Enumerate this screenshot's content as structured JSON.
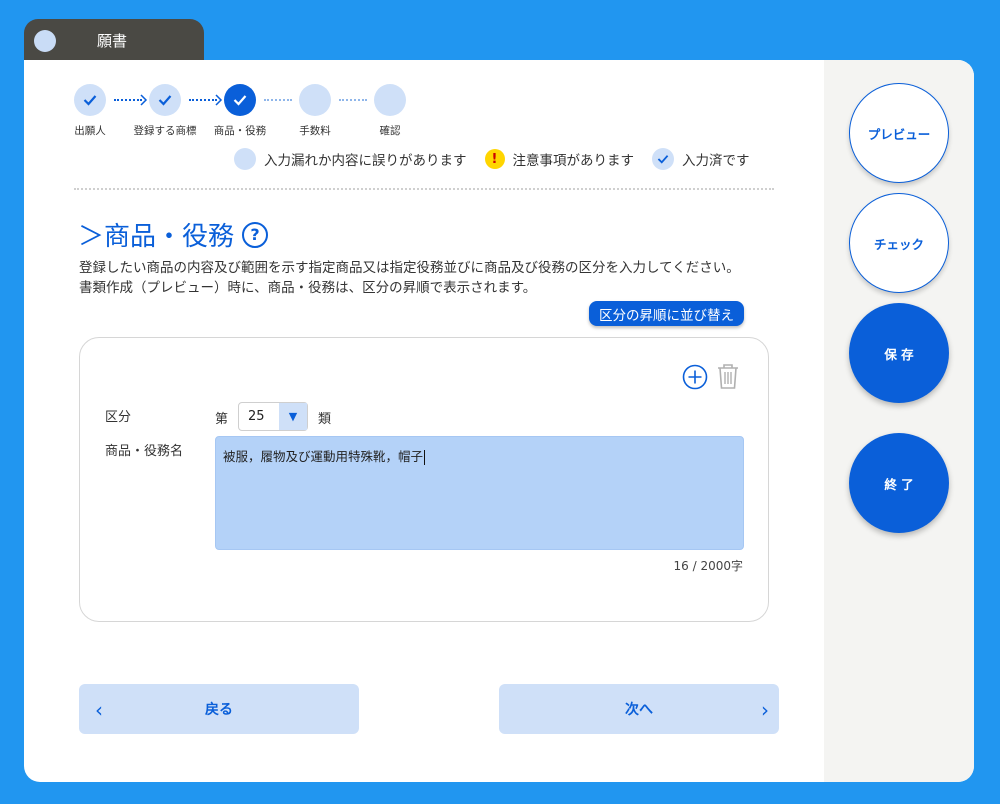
{
  "window": {
    "title": "願書"
  },
  "stepper": {
    "steps": [
      {
        "label": "出願人",
        "state": "done"
      },
      {
        "label": "登録する商標",
        "state": "done"
      },
      {
        "label": "商品・役務",
        "state": "current"
      },
      {
        "label": "手数料",
        "state": "pending"
      },
      {
        "label": "確認",
        "state": "pending"
      }
    ]
  },
  "legend": {
    "missing": "入力漏れか内容に誤りがあります",
    "warning": "注意事項があります",
    "done": "入力済です"
  },
  "section": {
    "prefix": "＞",
    "title": "商品・役務",
    "help_symbol": "?",
    "desc_line1": "登録したい商品の内容及び範囲を示す指定商品又は指定役務並びに商品及び役務の区分を入力してください。",
    "desc_line2": "書類作成（プレビュー）時に、商品・役務は、区分の昇順で表示されます。",
    "sort_button": "区分の昇順に並び替え"
  },
  "form": {
    "class_label": "区分",
    "class_prefix": "第",
    "class_value": "25",
    "class_suffix": "類",
    "goods_label": "商品・役務名",
    "goods_value": "被服，履物及び運動用特殊靴，帽子",
    "char_count": "16 / 2000字"
  },
  "nav": {
    "back": "戻る",
    "next": "次へ",
    "back_chevron": "‹",
    "next_chevron": "›"
  },
  "side": {
    "preview": "プレビュー",
    "check": "チェック",
    "save": "保 存",
    "exit": "終 了"
  },
  "colors": {
    "primary": "#0a5fd9",
    "light": "#cfe0f8",
    "background": "#2196f0"
  }
}
